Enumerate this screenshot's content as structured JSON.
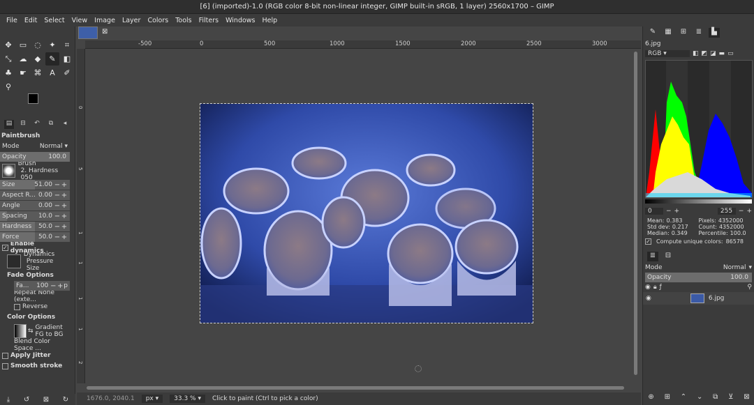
{
  "window": {
    "title": "[6] (imported)-1.0 (RGB color 8-bit non-linear integer, GIMP built-in sRGB, 1 layer) 2560x1700 – GIMP"
  },
  "menu": [
    "File",
    "Edit",
    "Select",
    "View",
    "Image",
    "Layer",
    "Colors",
    "Tools",
    "Filters",
    "Windows",
    "Help"
  ],
  "tool_options": {
    "title": "Paintbrush",
    "mode_label": "Mode",
    "mode_value": "Normal",
    "opacity_label": "Opacity",
    "opacity_value": "100.0",
    "opacity_level": 1.0,
    "brush_label": "Brush",
    "brush_value": "2. Hardness 050",
    "size_label": "Size",
    "size_value": "51.00",
    "size_level": 0.5,
    "aspect_label": "Aspect R...",
    "aspect_value": "0.00",
    "angle_label": "Angle",
    "angle_value": "0.00",
    "spacing_label": "Spacing",
    "spacing_value": "10.0",
    "spacing_level": 0.1,
    "hardness_label": "Hardness",
    "hardness_value": "50.0",
    "hardness_level": 0.5,
    "force_label": "Force",
    "force_value": "50.0",
    "force_level": 0.5,
    "enable_dynamics": "Enable dynamics",
    "dynamics_label": "Dynamics",
    "dynamics_value": "Pressure Size",
    "fade_options": "Fade Options",
    "fade_length_label": "Fa...",
    "fade_length_value": "100",
    "fade_unit": "p",
    "repeat": "Repeat None (exte...",
    "reverse": "Reverse",
    "color_options": "Color Options",
    "gradient_label": "Gradient",
    "gradient_value": "FG to BG",
    "blend_color_space": "Blend Color Space ...",
    "apply_jitter": "Apply Jitter",
    "smooth_stroke": "Smooth stroke"
  },
  "ruler": {
    "ticks": [
      "-500",
      "0",
      "500",
      "1000",
      "1500",
      "2000",
      "2500",
      "3000"
    ]
  },
  "ruler_v": {
    "ticks": [
      "0",
      "5",
      "1",
      "1",
      "1",
      "1",
      "2"
    ]
  },
  "status": {
    "coords": "1676.0, 2040.1",
    "unit": "px",
    "zoom": "33.3 %",
    "message": "Click to paint (Ctrl to pick a color)"
  },
  "histogram": {
    "file": "6.jpg",
    "channel": "RGB",
    "range_start": "0",
    "range_end": "255",
    "mean_label": "Mean:",
    "mean": "0.383",
    "stddev_label": "Std dev:",
    "stddev": "0.217",
    "median_label": "Median:",
    "median": "0.349",
    "pixels_label": "Pixels:",
    "pixels": "4352000",
    "count_label": "Count:",
    "count": "4352000",
    "percentile_label": "Percentile:",
    "percentile": "100.0",
    "compute_label": "Compute unique colors:",
    "unique": "86578"
  },
  "layers": {
    "mode_label": "Mode",
    "mode_value": "Normal",
    "opacity_label": "Opacity",
    "opacity_value": "100.0",
    "layer_name": "6.jpg"
  }
}
